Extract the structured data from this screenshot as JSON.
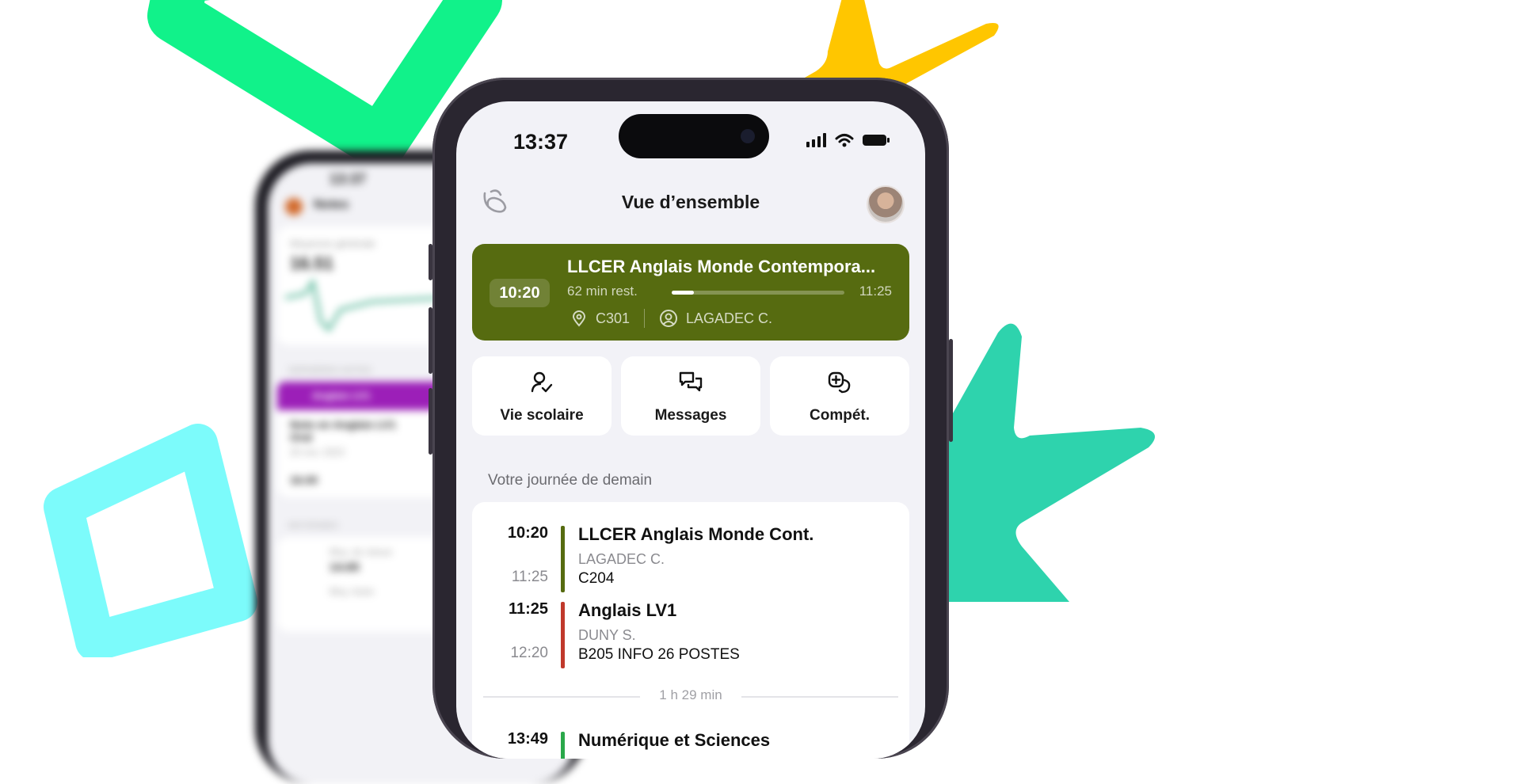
{
  "colors": {
    "course_card": "#566b10",
    "lesson_bar_1": "#566b10",
    "lesson_bar_2": "#c0392b",
    "lesson_bar_3": "#2aa84a",
    "deco_green": "#11f28a",
    "deco_yellow": "#ffc600",
    "deco_cyan": "#7cfbfb",
    "deco_teal": "#2ed3ad"
  },
  "back_phone": {
    "time": "13:37",
    "title": "Notes",
    "average_label": "Moyenne générale",
    "average_value": "16.51",
    "recent_label": "DERNIÈRES NOTES",
    "subject": "Anglais LV1",
    "note_title": "Note en Anglais LV1 Oral",
    "note_date": "20 nov. 2023",
    "note_value": "16.00",
    "averages_label": "MOYENNES",
    "class_avg_label": "Moy. de classe",
    "class_avg_value": "14.65",
    "other_label": "Moy. Autre"
  },
  "status_bar": {
    "time": "13:37"
  },
  "header": {
    "title": "Vue d’ensemble"
  },
  "current_course": {
    "start": "10:20",
    "title": "LLCER Anglais Monde Contempora...",
    "remaining": "62 min rest.",
    "progress": 0.13,
    "end": "11:25",
    "room": "C301",
    "teacher": "LAGADEC C."
  },
  "quick_actions": [
    {
      "label": "Vie scolaire",
      "icon": "user-check-icon"
    },
    {
      "label": "Messages",
      "icon": "chat-bubbles-icon"
    },
    {
      "label": "Compét.",
      "icon": "skills-icon"
    }
  ],
  "tomorrow": {
    "section_title": "Votre journée de demain",
    "lessons": [
      {
        "start": "10:20",
        "end": "11:25",
        "name": "LLCER Anglais Monde Cont.",
        "teacher": "LAGADEC C.",
        "room": "C204"
      },
      {
        "start": "11:25",
        "end": "12:20",
        "name": "Anglais LV1",
        "teacher": "DUNY S.",
        "room": "B205 INFO 26 POSTES"
      },
      {
        "start": "13:49",
        "name": "Numérique et Sciences"
      }
    ],
    "gap": "1 h 29 min"
  }
}
